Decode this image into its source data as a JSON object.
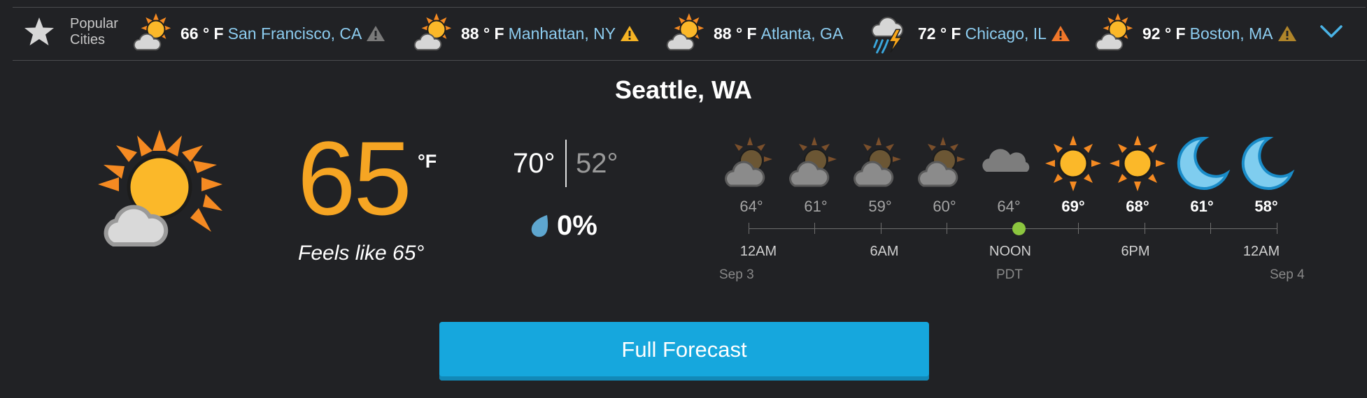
{
  "popular": {
    "label_line1": "Popular",
    "label_line2": "Cities",
    "cities": [
      {
        "temp": "66 ° F",
        "name": "San Francisco, CA",
        "icon": "partly-cloudy-icon",
        "alert": "gray"
      },
      {
        "temp": "88 ° F",
        "name": "Manhattan, NY",
        "icon": "partly-cloudy-icon",
        "alert": "yellow"
      },
      {
        "temp": "88 ° F",
        "name": "Atlanta, GA",
        "icon": "partly-cloudy-icon",
        "alert": null
      },
      {
        "temp": "72 ° F",
        "name": "Chicago, IL",
        "icon": "thunderstorm-icon",
        "alert": "orange"
      },
      {
        "temp": "92 ° F",
        "name": "Boston, MA",
        "icon": "partly-cloudy-icon",
        "alert": "brown"
      }
    ]
  },
  "location": "Seattle, WA",
  "current": {
    "temp": "65",
    "unit": "°F",
    "feels_like": "Feels like 65°",
    "high": "70°",
    "low": "52°",
    "precip": "0%",
    "icon": "partly-sunny-icon"
  },
  "hourly": [
    {
      "temp": "64°",
      "icon": "night-cloudy-icon",
      "highlight": false
    },
    {
      "temp": "61°",
      "icon": "night-cloudy-icon",
      "highlight": false
    },
    {
      "temp": "59°",
      "icon": "night-cloudy-icon",
      "highlight": false
    },
    {
      "temp": "60°",
      "icon": "night-cloudy-icon",
      "highlight": false
    },
    {
      "temp": "64°",
      "icon": "cloud-icon",
      "highlight": false
    },
    {
      "temp": "69°",
      "icon": "sun-icon",
      "highlight": true
    },
    {
      "temp": "68°",
      "icon": "sun-icon",
      "highlight": true
    },
    {
      "temp": "61°",
      "icon": "moon-icon",
      "highlight": true
    },
    {
      "temp": "58°",
      "icon": "moon-icon",
      "highlight": true
    }
  ],
  "timeline": {
    "labels": [
      "12AM",
      "6AM",
      "NOON",
      "6PM",
      "12AM"
    ],
    "date_start": "Sep 3",
    "timezone": "PDT",
    "date_end": "Sep 4"
  },
  "full_forecast_label": "Full Forecast",
  "colors": {
    "background": "#212225",
    "accent_temp": "#f6a523",
    "city_link": "#8dcdf0",
    "button": "#16a7dd",
    "now_dot": "#8cc63f"
  }
}
